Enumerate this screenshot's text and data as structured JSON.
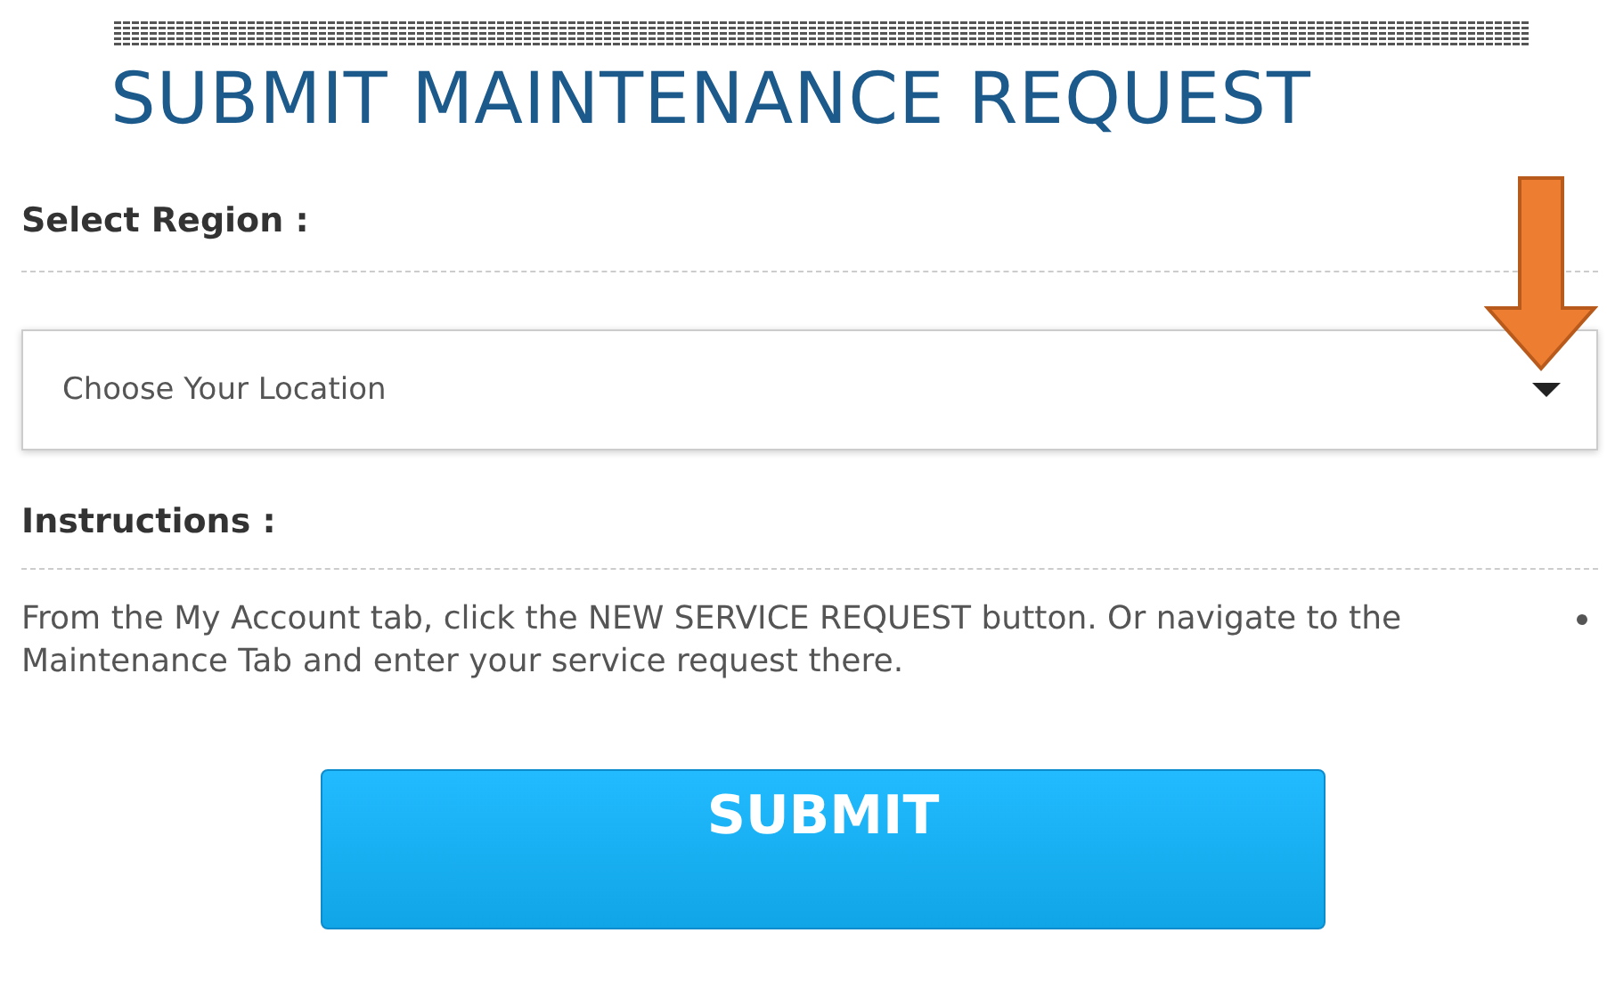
{
  "title": "SUBMIT MAINTENANCE REQUEST",
  "region": {
    "label": "Select Region :",
    "placeholder": "Choose Your Location"
  },
  "instructions": {
    "label": "Instructions :",
    "text": "From the My Account tab, click the NEW SERVICE REQUEST button. Or navigate to the Maintenance Tab and enter your service request there."
  },
  "submit_button": "SUBMIT"
}
